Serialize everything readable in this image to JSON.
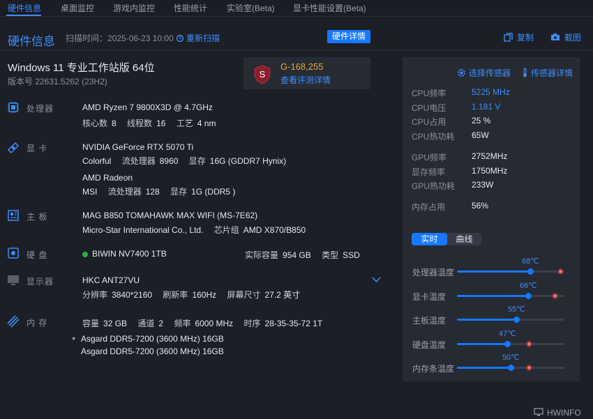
{
  "tabs": [
    "硬件信息",
    "桌面监控",
    "游戏内监控",
    "性能统计",
    "实验室(Beta)",
    "显卡性能设置(Beta)"
  ],
  "header": {
    "title": "硬件信息",
    "scan_time": "扫描时间：2025-06-23 10:00",
    "rescan": "重新扫描",
    "detail_button": "硬件详情",
    "copy": "复制",
    "screenshot": "截图"
  },
  "system": {
    "os": "Windows 11 专业工作站版 64位",
    "version": "版本号  22631.5262 (23H2)"
  },
  "score": {
    "badge": "S",
    "value": "G-168,255",
    "link": "查看评测详情"
  },
  "cpu": {
    "label": "处理器",
    "name": "AMD Ryzen 7 9800X3D @ 4.7GHz",
    "cores_label": "核心数",
    "cores": "8",
    "threads_label": "线程数",
    "threads": "16",
    "process_label": "工艺",
    "process": "4 nm"
  },
  "gpu": {
    "label": "显 卡",
    "cards": [
      {
        "name": "NVIDIA GeForce RTX 5070 Ti",
        "vendor": "Colorful",
        "sp_label": "流处理器",
        "sp": "8960",
        "mem_label": "显存",
        "mem": "16G (GDDR7 Hynix)"
      },
      {
        "name": "AMD Radeon",
        "vendor": "MSI",
        "sp_label": "流处理器",
        "sp": "128",
        "mem_label": "显存",
        "mem": "1G (DDR5 )"
      }
    ]
  },
  "board": {
    "label": "主 板",
    "name": "MAG B850 TOMAHAWK MAX WIFI (MS-7E62)",
    "maker": "Micro-Star International Co., Ltd.",
    "chipset_label": "芯片组",
    "chipset": "AMD X870/B850"
  },
  "disk": {
    "label": "硬 盘",
    "name": "BIWIN NV7400 1TB",
    "cap_label": "实际容量",
    "cap": "954 GB",
    "type_label": "类型",
    "type": "SSD"
  },
  "display": {
    "label": "显示器",
    "name": "HKC ANT27VU",
    "res_label": "分辨率",
    "res": "3840*2160",
    "rate_label": "刷新率",
    "rate": "160Hz",
    "size_label": "屏幕尺寸",
    "size": "27.2 英寸"
  },
  "memory": {
    "label": "内 存",
    "cap_label": "容量",
    "cap": "32 GB",
    "ch_label": "通道",
    "ch": "2",
    "freq_label": "频率",
    "freq": "6000 MHz",
    "timing_label": "时序",
    "timing": "28-35-35-72 1T",
    "sticks": [
      "Asgard DDR5-7200 (3600 MHz) 16GB",
      "Asgard DDR5-7200 (3600 MHz) 16GB"
    ]
  },
  "sensors": {
    "select": "选择传感器",
    "detail": "传感器详情",
    "metrics": [
      {
        "label": "CPU频率",
        "value": "5225 MHz"
      },
      {
        "label": "CPU电压",
        "value": "1.181 V"
      },
      {
        "label": "CPU占用",
        "value": "25 %"
      },
      {
        "label": "CPU热功耗",
        "value": "65W"
      },
      {
        "label": "GPU频率",
        "value": "2752MHz"
      },
      {
        "label": "显存频率",
        "value": "1750MHz"
      },
      {
        "label": "GPU热功耗",
        "value": " 233W"
      },
      {
        "label": "内存占用",
        "value": "56%"
      }
    ],
    "mode_realtime": "实时",
    "mode_curve": "曲线",
    "temps": [
      {
        "label": "处理器温度",
        "value": "68℃",
        "level": 0.68,
        "max": 0.96
      },
      {
        "label": "显卡温度",
        "value": "66℃",
        "level": 0.66,
        "max": 0.91
      },
      {
        "label": "主板温度",
        "value": "55℃",
        "level": 0.55,
        "max": null
      },
      {
        "label": "硬盘温度",
        "value": "47℃",
        "level": 0.47,
        "max": 0.67
      },
      {
        "label": "内存条温度",
        "value": "50℃",
        "level": 0.5,
        "max": 0.67
      }
    ]
  },
  "footer": {
    "brand": "HWINFO"
  },
  "colors": {
    "accent": "#1677ff",
    "link": "#3d8eff",
    "score": "#e8a736",
    "ok": "#2fae4a"
  }
}
